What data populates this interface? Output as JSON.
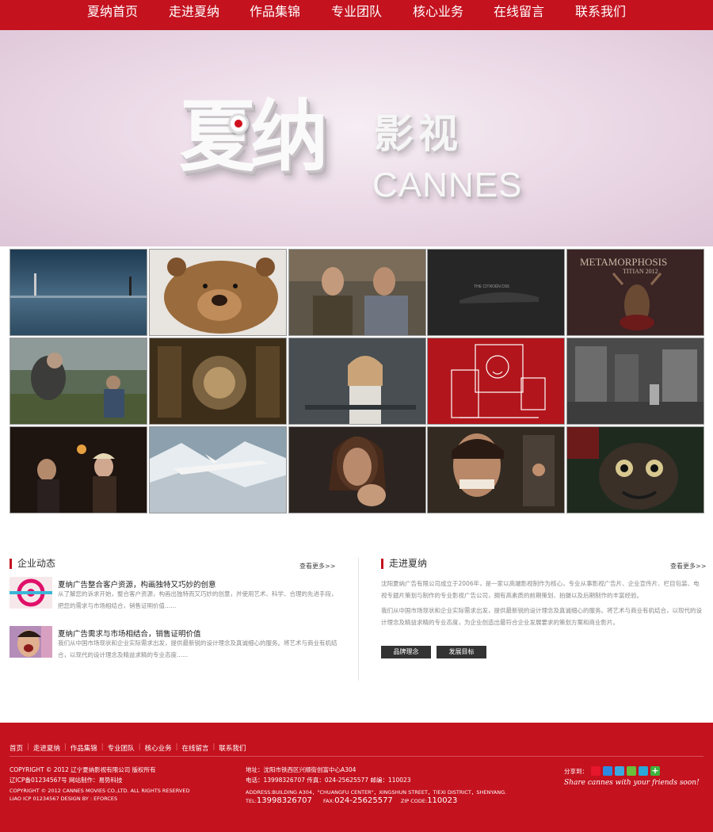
{
  "nav": [
    "夏纳首页",
    "走进夏纳",
    "作品集锦",
    "专业团队",
    "核心业务",
    "在线留言",
    "联系我们"
  ],
  "banner": {
    "logo_cn": "夏纳",
    "logo_sub": "影视",
    "logo_en": "CANNES"
  },
  "gallery": {
    "labels": {
      "citroen": "THE CITROËN DS5",
      "metamorphosis_title": "METAMORPHOSIS",
      "metamorphosis_sub": "TITIAN 2012"
    }
  },
  "news": {
    "title": "企业动态",
    "more": "查看更多>>",
    "items": [
      {
        "heading": "夏纳广告整合客户资源，构画独特又巧妙的创意",
        "text": "从了解您的诉求开始，整合客户资源，构画出独特而又巧妙的创意，并使用艺术、科学、合理的先进手段，把您的需求与市场相结合，销售证明价值......"
      },
      {
        "heading": "夏纳广告需求与市场相结合，销售证明价值",
        "text": "我们从中国市场现状和企业实际需求出发，提供最新锐的设计理念及真诚细心的服务。将艺术与商业有机结合，以现代的设计理念及精益求精的专业态度......"
      }
    ]
  },
  "about": {
    "title": "走进夏纳",
    "more": "查看更多>>",
    "p1": "沈阳夏纳广告有限公司成立于2006年，是一家以高端影视制作为核心，专业从事影视广告片、企业宣传片、栏目包装、电视专题片策划与制作的专业影视广告公司，拥有高素质的前期策划、拍摄以及后期制作的丰富经验。",
    "p2": "我们从中国市场现状和企业实际需求出发，提供最新锐的设计理念及真诚细心的服务。将艺术与商业有机结合，以现代的设计理念及精益求精的专业态度，为企业创造出最符合企业发展要求的策划方案和商业影片。",
    "buttons": [
      "品牌理念",
      "发展目标"
    ]
  },
  "footer": {
    "nav": [
      "首页",
      "走进夏纳",
      "作品集锦",
      "专业团队",
      "核心业务",
      "在线留言",
      "联系我们"
    ],
    "copyright_cn": "COPYRIGHT © 2012 辽宁夏纳影视有限公司 版权所有",
    "icp_cn": "辽ICP备01234567号  网站制作：易势科技",
    "copyright_en": "COPYRIGHT © 2012 CANNES MOVIES CO.,LTD. ALL RIGHTS RESERVED",
    "icp_en": "LIAO ICP 01234567  DESIGN BY : EFORCES",
    "address_cn": "地址：沈阳市铁西区兴顺街创富中心A304",
    "phone_cn": "电话：13998326707 传真：024-25625577 邮编：110023",
    "address_en": "ADDRESS:BUILDING A304，\"CHUANGFU CENTER\"，XINGSHUN STREET，TIEXI DISTRICT，SHENYANG.",
    "tel_label": "TEL:",
    "tel": "13998326707",
    "fax_label": "FAX:",
    "fax": "024-25625577",
    "zip_label": "ZIP CODE:",
    "zip": "110023",
    "share_label": "分享到：",
    "share_slogan": "Share cannes with your friends soon!"
  },
  "colors": {
    "brand": "#c4121f",
    "button": "#333333"
  }
}
